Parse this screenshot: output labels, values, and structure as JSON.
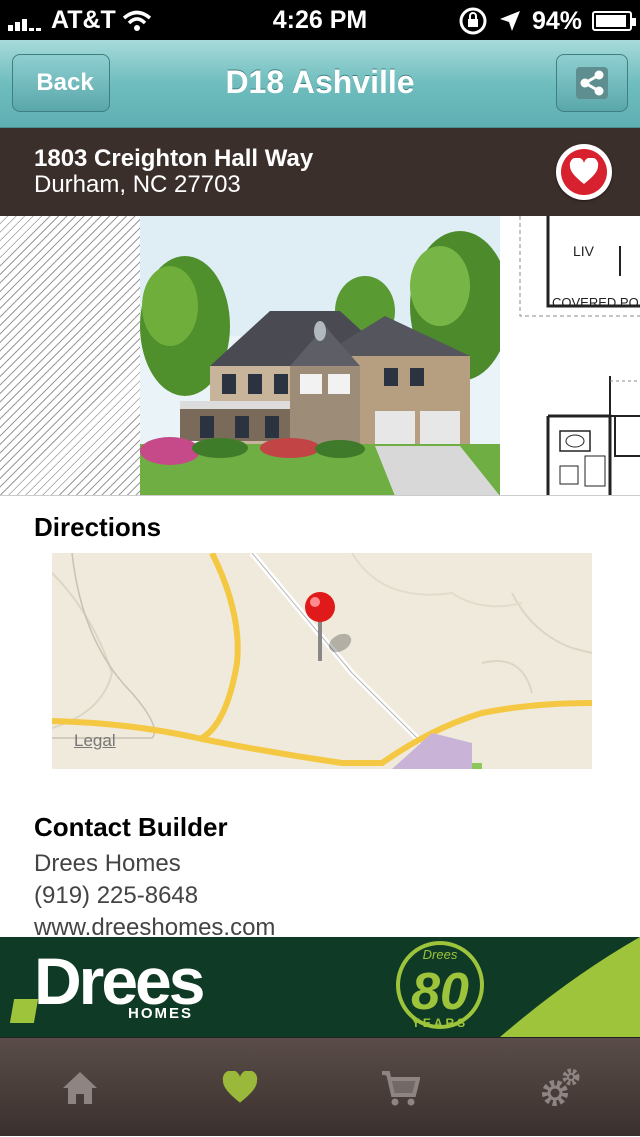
{
  "status_bar": {
    "carrier": "AT&T",
    "time": "4:26 PM",
    "battery": "94%",
    "battery_level": 0.94,
    "icons": [
      "signal-icon",
      "wifi-icon",
      "rotation-lock-icon",
      "location-icon",
      "battery-icon"
    ]
  },
  "nav": {
    "back_label": "Back",
    "title": "D18 Ashville",
    "share_icon": "share-icon"
  },
  "address": {
    "line1": "1803 Creighton Hall Way",
    "line2": "Durham, NC 27703",
    "favorite_icon": "heart-icon"
  },
  "gallery": {
    "floorplan_labels": [
      "LIV",
      "COVERED PO"
    ]
  },
  "directions": {
    "title": "Directions",
    "map_legal": "Legal"
  },
  "contact": {
    "title": "Contact Builder",
    "builder": "Drees Homes",
    "phone": "(919) 225-8648",
    "website": "www.dreeshomes.com"
  },
  "banner": {
    "brand": "Drees",
    "sub": "HOMES",
    "badge_top": "Drees",
    "badge_number": "80",
    "badge_bottom": "YEARS"
  },
  "tabs": [
    {
      "icon": "home-icon",
      "active": false
    },
    {
      "icon": "heart-icon",
      "active": true
    },
    {
      "icon": "cart-icon",
      "active": false
    },
    {
      "icon": "gear-icon",
      "active": false
    }
  ],
  "colors": {
    "nav_teal": "#6fbdbe",
    "address_bg": "#3b2f2c",
    "favorite_red": "#d8212f",
    "banner_green": "#0f3b26",
    "accent_lime": "#9ec43b",
    "tab_inactive": "#8e8582",
    "tab_active": "#9ab83a"
  }
}
